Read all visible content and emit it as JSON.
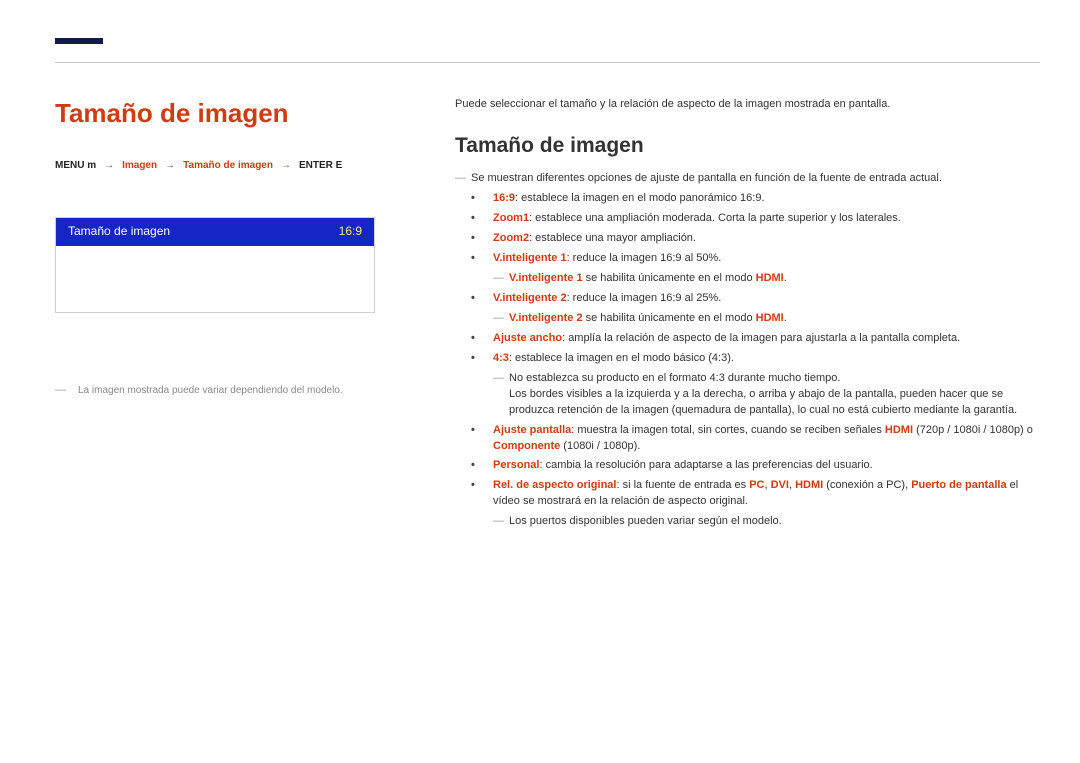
{
  "left": {
    "title": "Tamaño de imagen",
    "crumbs": {
      "menu": "MENU m",
      "sep": "→",
      "a": "Imagen",
      "b": "Tamaño de imagen",
      "enter": "ENTER E"
    },
    "menu": {
      "label": "Tamaño de imagen",
      "value": "16:9"
    },
    "note": "La imagen mostrada puede variar dependiendo del modelo."
  },
  "right": {
    "intro": "Puede seleccionar el tamaño y la relación de aspecto de la imagen mostrada en pantalla.",
    "heading": "Tamaño de imagen",
    "lead": "Se muestran diferentes opciones de ajuste de pantalla en función de la fuente de entrada actual.",
    "items": {
      "i1": {
        "term": "16:9",
        "rest": ": establece la imagen en el modo panorámico 16:9."
      },
      "i2": {
        "term": "Zoom1",
        "rest": ": establece una ampliación moderada. Corta la parte superior y los laterales."
      },
      "i3": {
        "term": "Zoom2",
        "rest": ": establece una mayor ampliación."
      },
      "i4": {
        "term": "V.inteligente 1",
        "rest": ": reduce la imagen 16:9 al 50%."
      },
      "i4s": {
        "term": "V.inteligente 1",
        "rest": " se habilita únicamente en el modo ",
        "tail": "HDMI",
        "dot": "."
      },
      "i5": {
        "term": "V.inteligente 2",
        "rest": ": reduce la imagen 16:9 al 25%."
      },
      "i5s": {
        "term": "V.inteligente 2",
        "rest": " se habilita únicamente en el modo ",
        "tail": "HDMI",
        "dot": "."
      },
      "i6": {
        "term": "Ajuste ancho",
        "rest": ": amplía la relación de aspecto de la imagen para ajustarla a la pantalla completa."
      },
      "i7": {
        "term": "4:3",
        "rest": ": establece la imagen en el modo básico (4:3)."
      },
      "i7s1": "No establezca su producto en el formato 4:3 durante mucho tiempo.",
      "i7s2": "Los bordes visibles a la izquierda y a la derecha, o arriba y abajo de la pantalla, pueden hacer que se produzca retención de la imagen (quemadura de pantalla), lo cual no está cubierto mediante la garantía.",
      "i8": {
        "term": "Ajuste pantalla",
        "rest": ": muestra la imagen total, sin cortes, cuando se reciben señales ",
        "a": "HDMI",
        "apar": " (720p / 1080i / 1080p) o ",
        "b": "Componente",
        "bpar": " (1080i / 1080p)."
      },
      "i9": {
        "term": "Personal",
        "rest": ": cambia la resolución para adaptarse a las preferencias del usuario."
      },
      "i10": {
        "term": "Rel. de aspecto original",
        "lead": ": si la fuente de entrada es ",
        "p1": "PC",
        "c1": ", ",
        "p2": "DVI",
        "c2": ", ",
        "p3": "HDMI",
        "c3": " (conexión a PC), ",
        "p4": "Puerto de pantalla",
        "tail": " el vídeo se mostrará en la relación de aspecto original."
      },
      "i11": "Los puertos disponibles pueden variar según el modelo."
    }
  }
}
